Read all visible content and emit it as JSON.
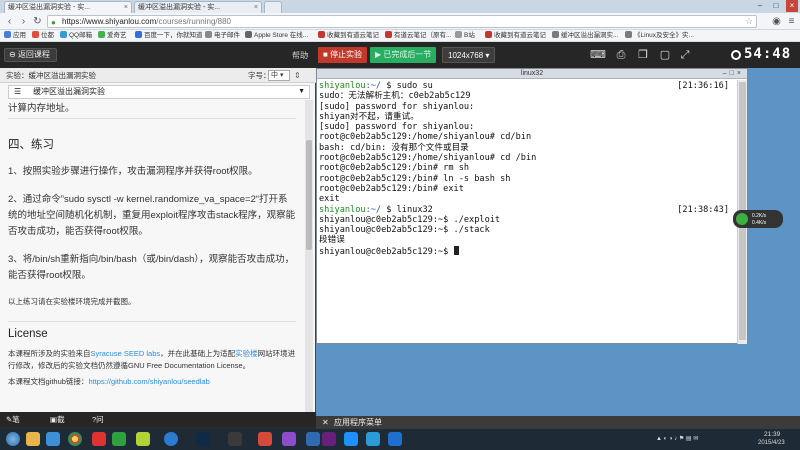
{
  "browser": {
    "tabs": [
      {
        "label": "缓冲区溢出漏洞实验 - 实..."
      },
      {
        "label": "缓冲区溢出漏洞实验 - 实..."
      }
    ],
    "url": {
      "host": "https://www.shiyanlou.com",
      "path": "/courses/running/880"
    },
    "bookmarks": [
      {
        "label": "应用",
        "color": "#4a7fd6"
      },
      {
        "label": "位都",
        "color": "#e04b3a"
      },
      {
        "label": "QQ邮箱",
        "color": "#3a9ad9"
      },
      {
        "label": "爱奇艺",
        "color": "#42b548"
      },
      {
        "label": "百度一下，你就知道",
        "color": "#2f6fe0"
      },
      {
        "label": "电子邮件",
        "color": "#888888"
      },
      {
        "label": "Apple Store 在线...",
        "color": "#666666"
      },
      {
        "label": "收藏到有道云笔记",
        "color": "#c0392b"
      },
      {
        "label": "有道云笔记（原有...",
        "color": "#c0392b"
      },
      {
        "label": "B站",
        "color": "#999999"
      },
      {
        "label": "收藏到有道云笔记",
        "color": "#c0392b"
      },
      {
        "label": "缓冲区溢出漏洞实...",
        "color": "#7a7a7a"
      },
      {
        "label": "《Linux及安全》实...",
        "color": "#7a7a7a"
      }
    ]
  },
  "lab_header": {
    "back_label": "返回课程",
    "help_label": "帮助",
    "stop_label": "停止实验",
    "next_label": "已完成后一节",
    "resolution_label": "1024x768",
    "timer": "54:48"
  },
  "left_panel": {
    "experiment_label": "实验：缓冲区溢出漏洞实验",
    "font_label": "字号：",
    "font_value": "中",
    "toc_title": "缓冲区溢出漏洞实验",
    "doc": {
      "partial_line": "计算内存地址。",
      "section_title": "四、练习",
      "items": [
        "1、按照实验步骤进行操作，攻击漏洞程序并获得root权限。",
        "2、通过命令”sudo sysctl -w kernel.randomize_va_space=2“打开系统的地址空间随机化机制，重复用exploit程序攻击stack程序，观察能否攻击成功，能否获得root权限。",
        "3、将/bin/sh重新指向/bin/bash（或/bin/dash），观察能否攻击成功，能否获得root权限。"
      ],
      "note": "以上练习请在实验楼环境完成并截图。",
      "license_title": "License",
      "license_text_a": "本课程所涉及的实验来自",
      "license_link_a": "Syracuse SEED labs",
      "license_text_b": "，并在此基础上为适配",
      "license_link_b": "实验楼",
      "license_text_c": "网站环境进行修改，修改后的实验文档仍然遵循GNU Free Documentation License。",
      "repo_label": "本课程文档github链接：",
      "repo_link": "https://github.com/shiyanlou/seedlab"
    },
    "bottom": {
      "notes": "笔记",
      "screenshot": "截图",
      "qa": "问答"
    }
  },
  "terminal": {
    "title": "linux32",
    "lines": [
      {
        "user": "shiyanlou",
        "path": ":~/",
        "cmd": " $ sudo su",
        "ts": "[21:36:16]"
      },
      {
        "text": "sudo：无法解析主机：c0eb2ab5c129"
      },
      {
        "text": "[sudo] password for shiyanlou:"
      },
      {
        "text": "shiyan对不起，请重试。"
      },
      {
        "text": "[sudo] password for shiyanlou:"
      },
      {
        "text": "root@c0eb2ab5c129:/home/shiyanlou# cd/bin"
      },
      {
        "text": "bash: cd/bin: 没有那个文件或目录"
      },
      {
        "text": "root@c0eb2ab5c129:/home/shiyanlou# cd /bin"
      },
      {
        "text": "root@c0eb2ab5c129:/bin# rm sh"
      },
      {
        "text": "root@c0eb2ab5c129:/bin# ln -s bash sh"
      },
      {
        "text": "root@c0eb2ab5c129:/bin# exit"
      },
      {
        "text": "exit"
      },
      {
        "user": "shiyanlou",
        "path": ":~/",
        "cmd": " $ linux32",
        "ts": "[21:38:43]"
      },
      {
        "text": "shiyanlou@c0eb2ab5c129:~$ ./exploit"
      },
      {
        "text": "shiyanlou@c0eb2ab5c129:~$ ./stack"
      },
      {
        "text": "段错误"
      },
      {
        "text": "shiyanlou@c0eb2ab5c129:~$ ",
        "cursor": true
      }
    ]
  },
  "net_widget": {
    "up": "0.2K/s",
    "down": "0.4K/s"
  },
  "vm_taskbar": {
    "menu_label": "应用程序菜单"
  },
  "win_tray": {
    "time": "21:39",
    "date": "2015/4/23"
  }
}
